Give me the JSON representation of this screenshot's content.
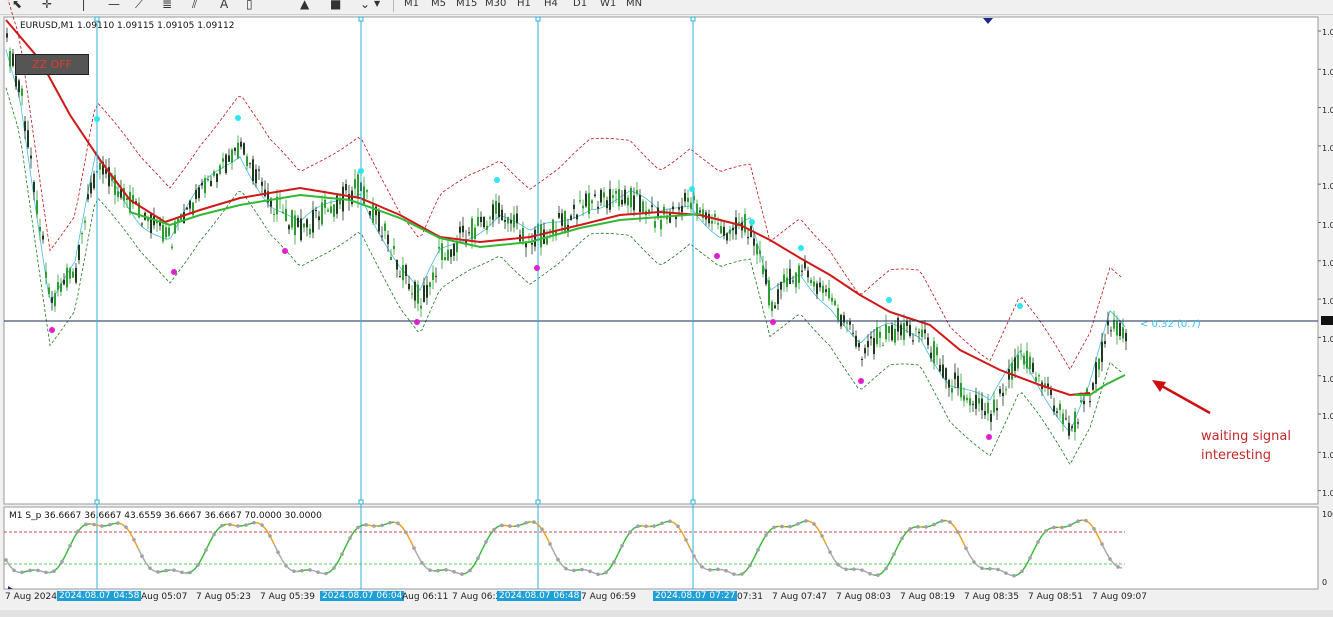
{
  "toolbar": {
    "timeframes": [
      "M1",
      "M5",
      "M15",
      "M30",
      "H1",
      "H4",
      "D1",
      "W1",
      "MN"
    ],
    "icons": [
      "cursor-icon",
      "crosshair-icon",
      "vertical-line-icon",
      "horizontal-line-icon",
      "trendline-icon",
      "fibonacci-icon",
      "text-icon",
      "arrow-up-icon",
      "shapes-icon",
      "more-icon"
    ]
  },
  "chart": {
    "header": "EURUSD,M1  1.09110 1.09115 1.09105 1.09112",
    "zz_button": "ZZ OFF",
    "price_labels": [
      "1.0",
      "1.0",
      "1.0",
      "1.0",
      "1.0",
      "1.0",
      "1.0",
      "1.0",
      "1.0",
      "1.0",
      "1.0",
      "1.0",
      "1.0"
    ],
    "info_label": "< 0.32 (0.7)",
    "annotation_line1": "waiting signal",
    "annotation_line2": "interesting"
  },
  "indicator": {
    "header": "M1 S_p 36.6667 36.6667 43.6559 36.6667 36.6667 70.0000 30.0000",
    "scale_top": "100",
    "scale_bottom": "0"
  },
  "time_axis": {
    "labels": [
      "7 Aug 2024",
      "Aug 05:07",
      "7 Aug 05:23",
      "7 Aug 05:39",
      "Aug 06:11",
      "7 Aug 06:59",
      "07:31",
      "7 Aug 07:47",
      "7 Aug 08:03",
      "7 Aug 08:19",
      "7 Aug 08:35",
      "7 Aug 08:51",
      "7 Aug 09:07"
    ],
    "highlighted": [
      "2024.08.07 04:58",
      "2024.08.07 06:04",
      "2024.08.07 06:48",
      "2024.08.07 07:27"
    ],
    "partial": [
      "7 Aug 06:2"
    ]
  },
  "colors": {
    "bull_candle": "#2e9e33",
    "bear_candle": "#1f3a1f",
    "ma_red": "#d01818",
    "ma_green": "#34b834",
    "vline": "#2bb0d8",
    "dot_cyan": "#2ee6f0",
    "dot_magenta": "#e020d0"
  }
}
